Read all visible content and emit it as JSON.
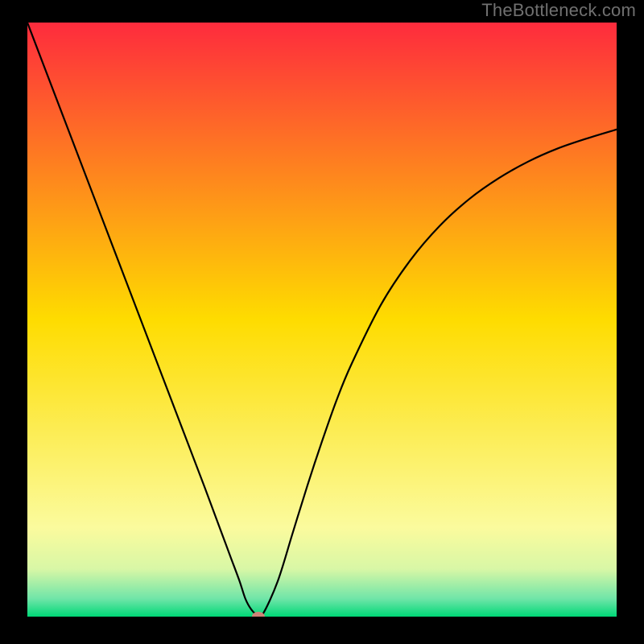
{
  "watermark": "TheBottleneck.com",
  "chart_data": {
    "type": "line",
    "title": "",
    "xlabel": "",
    "ylabel": "",
    "xlim": [
      0,
      100
    ],
    "ylim": [
      0,
      100
    ],
    "background_gradient": {
      "stops": [
        {
          "offset": 0.0,
          "color": "#fe2b3d"
        },
        {
          "offset": 0.5,
          "color": "#fedc00"
        },
        {
          "offset": 0.85,
          "color": "#fbfb9d"
        },
        {
          "offset": 0.92,
          "color": "#d8f7a6"
        },
        {
          "offset": 0.97,
          "color": "#6fe5a8"
        },
        {
          "offset": 1.0,
          "color": "#00d877"
        }
      ]
    },
    "series": [
      {
        "name": "bottleneck-curve",
        "color": "#000000",
        "x": [
          0.0,
          2.5,
          5.0,
          7.5,
          10.0,
          12.5,
          15.0,
          17.5,
          20.0,
          22.5,
          25.0,
          27.5,
          30.0,
          31.5,
          33.0,
          34.5,
          36.0,
          37.0,
          38.0,
          39.0,
          40.0,
          42.5,
          45.0,
          47.5,
          50.0,
          52.5,
          55.0,
          60.0,
          65.0,
          70.0,
          75.0,
          80.0,
          85.0,
          90.0,
          95.0,
          100.0
        ],
        "y": [
          100.0,
          93.5,
          87.0,
          80.5,
          74.0,
          67.5,
          61.0,
          54.5,
          48.0,
          41.5,
          35.0,
          28.5,
          22.0,
          18.0,
          14.0,
          10.0,
          6.0,
          3.0,
          1.2,
          0.3,
          0.5,
          6.0,
          14.0,
          22.0,
          29.5,
          36.5,
          42.5,
          52.5,
          60.0,
          65.8,
          70.3,
          73.8,
          76.6,
          78.8,
          80.5,
          82.0
        ]
      }
    ],
    "marker": {
      "name": "optimal-point",
      "x": 39.2,
      "y": 0.0,
      "color": "#cf8377",
      "rx": 8,
      "ry": 6
    }
  }
}
